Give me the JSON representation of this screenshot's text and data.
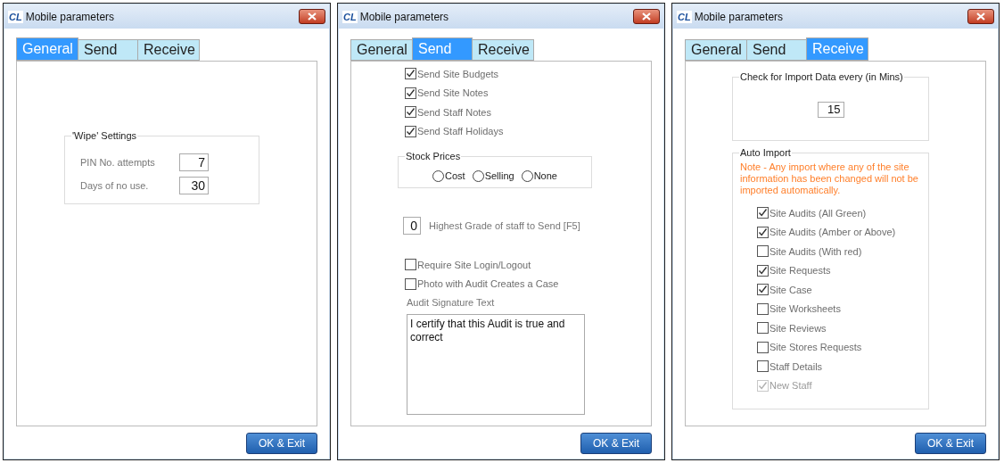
{
  "windows": [
    {
      "logo": "CL",
      "title": "Mobile parameters",
      "tabs": [
        {
          "label": "General",
          "selected": true
        },
        {
          "label": "Send",
          "selected": false
        },
        {
          "label": "Receive",
          "selected": false
        }
      ],
      "panel": {
        "kind": "general",
        "group": {
          "title": "'Wipe' Settings",
          "fields": [
            {
              "label": "PIN No. attempts",
              "value": "7"
            },
            {
              "label": "Days of no use.",
              "value": "30"
            }
          ]
        }
      },
      "button": "OK & Exit"
    },
    {
      "logo": "CL",
      "title": "Mobile parameters",
      "tabs": [
        {
          "label": "General",
          "selected": false
        },
        {
          "label": "Send",
          "selected": true
        },
        {
          "label": "Receive",
          "selected": false
        }
      ],
      "panel": {
        "kind": "send",
        "checkboxes": [
          {
            "label": "Send Site Budgets",
            "checked": true
          },
          {
            "label": "Send Site Notes",
            "checked": true
          },
          {
            "label": "Send Staff Notes",
            "checked": true
          },
          {
            "label": "Send Staff Holidays",
            "checked": true
          }
        ],
        "stock_prices": {
          "title": "Stock Prices",
          "options": [
            {
              "label": "Cost",
              "selected": false
            },
            {
              "label": "Selling",
              "selected": false
            },
            {
              "label": "None",
              "selected": false
            }
          ]
        },
        "grade": {
          "value": "0",
          "label": "Highest Grade of staff to Send [F5]"
        },
        "options": [
          {
            "label": "Require Site Login/Logout",
            "checked": false
          },
          {
            "label": "Photo with Audit Creates a Case",
            "checked": false
          }
        ],
        "signature": {
          "label": "Audit Signature Text",
          "value": "I certify that this Audit is true and correct"
        }
      },
      "button": "OK & Exit"
    },
    {
      "logo": "CL",
      "title": "Mobile parameters",
      "tabs": [
        {
          "label": "General",
          "selected": false
        },
        {
          "label": "Send",
          "selected": false
        },
        {
          "label": "Receive",
          "selected": true
        }
      ],
      "panel": {
        "kind": "receive",
        "interval": {
          "title": "Check for Import Data every (in Mins)",
          "value": "15"
        },
        "auto_import": {
          "title": "Auto Import",
          "note": "Note - Any import where any of the site information has been changed will not be imported automatically.",
          "items": [
            {
              "label": "Site Audits (All Green)",
              "checked": true,
              "disabled": false
            },
            {
              "label": "Site Audits (Amber or Above)",
              "checked": true,
              "disabled": false
            },
            {
              "label": "Site Audits (With red)",
              "checked": false,
              "disabled": false
            },
            {
              "label": "Site Requests",
              "checked": true,
              "disabled": false
            },
            {
              "label": "Site Case",
              "checked": true,
              "disabled": false
            },
            {
              "label": "Site Worksheets",
              "checked": false,
              "disabled": false
            },
            {
              "label": "Site Reviews",
              "checked": false,
              "disabled": false
            },
            {
              "label": "Site Stores Requests",
              "checked": false,
              "disabled": false
            },
            {
              "label": "Staff Details",
              "checked": false,
              "disabled": false
            },
            {
              "label": "New Staff",
              "checked": true,
              "disabled": true
            }
          ]
        }
      },
      "button": "OK & Exit"
    }
  ]
}
